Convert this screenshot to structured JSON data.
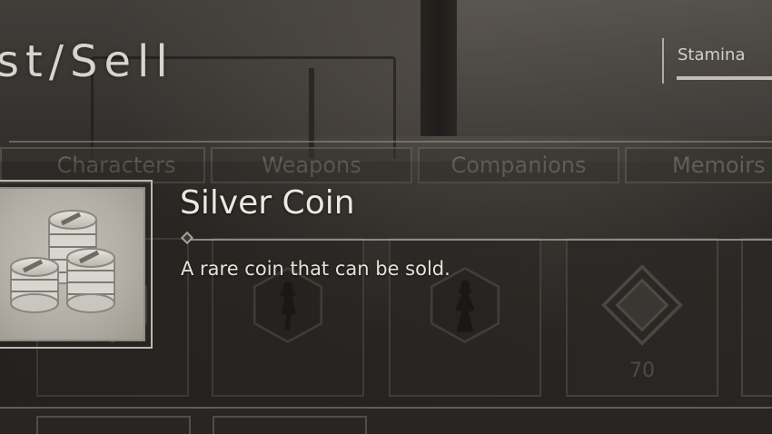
{
  "header": {
    "title": "st/Sell",
    "stamina_label": "Stamina"
  },
  "tabs": [
    {
      "label": "Characters"
    },
    {
      "label": "Weapons"
    },
    {
      "label": "Companions"
    },
    {
      "label": "Memoirs"
    }
  ],
  "grid": {
    "cards": [
      {
        "icon": "character-doll-icon",
        "count": ""
      },
      {
        "icon": "character-doll-icon",
        "count": ""
      },
      {
        "icon": "character-doll-icon",
        "count": ""
      },
      {
        "icon": "ornament-icon",
        "count": "70"
      },
      {
        "icon": "blank",
        "count": ""
      }
    ]
  },
  "item_detail": {
    "name": "Silver Coin",
    "description": "A rare coin that can be sold.",
    "icon": "silver-coins-icon"
  },
  "colors": {
    "text_primary": "#ece8df",
    "frame": "#bdb8ae",
    "background": "#2a2723"
  }
}
